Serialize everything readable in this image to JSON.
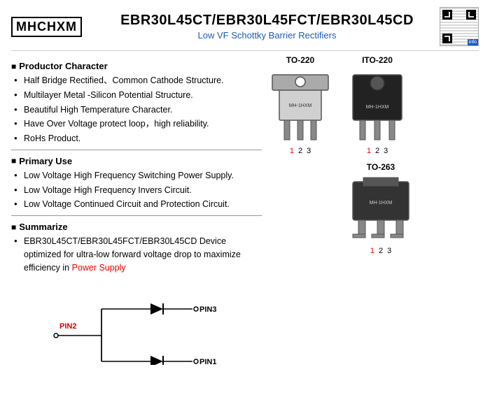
{
  "header": {
    "logo": "MHCHXM",
    "title": "EBR30L45CT/EBR30L45FCT/EBR30L45CD",
    "subtitle": "Low VF Schottky Barrier Rectifiers"
  },
  "sections": {
    "productor": {
      "title": "Productor Character",
      "bullets": [
        "Half Bridge Rectified、Common Cathode Structure.",
        "Multilayer Metal -Silicon Potential Structure.",
        "Beautiful High Temperature Character.",
        "Have Over Voltage protect loop，high  reliability.",
        "RoHs Product."
      ]
    },
    "primaryUse": {
      "title": "Primary Use",
      "bullets": [
        "Low Voltage High Frequency Switching Power Supply.",
        "Low Voltage High Frequency  Invers Circuit.",
        "Low Voltage Continued  Circuit and Protection Circuit."
      ]
    },
    "summarize": {
      "title": "Summarize",
      "text1": "EBR30L45CT/EBR30L45FCT/EBR30L45CD Device optimized for ultra-low forward voltage drop to maximize efficiency in ",
      "highlight": "Power Supply",
      "text2": ""
    }
  },
  "packages": [
    {
      "label": "TO-220",
      "pins": [
        "1",
        "2",
        "3"
      ]
    },
    {
      "label": "ITO-220",
      "pins": [
        "1",
        "2",
        "3"
      ]
    },
    {
      "label": "TO-263",
      "pins": [
        "1",
        "2",
        "3"
      ]
    }
  ],
  "circuit": {
    "pin1_label": "PIN1",
    "pin2_label": "PIN2",
    "pin3_label": "PIN3"
  }
}
